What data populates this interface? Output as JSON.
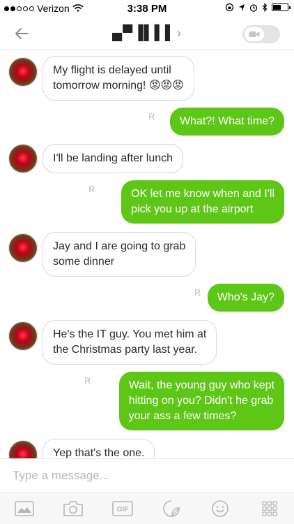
{
  "status_bar": {
    "carrier": "Verizon",
    "time": "3:38 PM"
  },
  "header": {
    "contact_name": "▄▀▐▌▌▌",
    "chevron": "›"
  },
  "messages": [
    {
      "direction": "incoming",
      "text": "My flight is delayed until\ntomorrow morning! 😡😡😡"
    },
    {
      "direction": "outgoing",
      "text": "What?! What time?",
      "receipt": "R"
    },
    {
      "direction": "incoming",
      "text": "I'll be landing after lunch"
    },
    {
      "direction": "outgoing",
      "text": "OK let me know when and I'll\npick you up at the airport",
      "receipt": "R"
    },
    {
      "direction": "incoming",
      "text": "Jay and I are going to grab\nsome dinner"
    },
    {
      "direction": "outgoing",
      "text": "Who's Jay?",
      "receipt": "R"
    },
    {
      "direction": "incoming",
      "text": "He's the IT guy. You met him at\nthe Christmas party last year."
    },
    {
      "direction": "outgoing",
      "text": "Wait, the young guy who kept\nhitting on you? Didn't he grab\nyour ass a few times?",
      "receipt": "R"
    },
    {
      "direction": "incoming",
      "text": "Yep that's the one."
    }
  ],
  "composer": {
    "placeholder": "Type a message..."
  },
  "toolbar": {
    "gif_label": "GIF",
    "icons": [
      "image-icon",
      "camera-icon",
      "gif-icon",
      "sticker-icon",
      "emoji-icon",
      "apps-grid-icon"
    ]
  },
  "colors": {
    "outgoing_bubble": "#5ec616",
    "incoming_border": "#d9d9d9",
    "icon_gray": "#b5b5b5"
  }
}
